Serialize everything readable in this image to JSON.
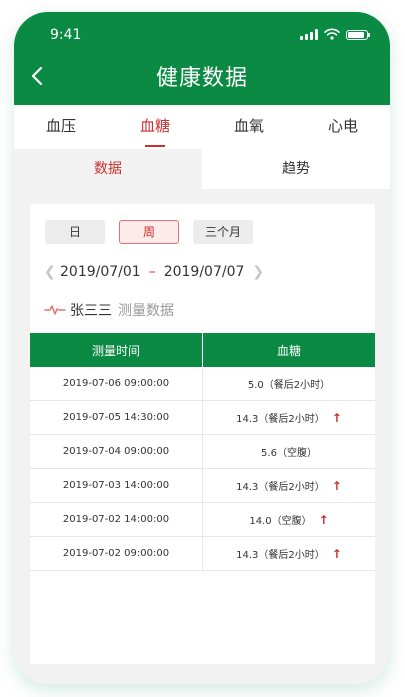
{
  "status_bar": {
    "time": "9:41"
  },
  "header": {
    "title": "健康数据"
  },
  "tabs": [
    {
      "label": "血压"
    },
    {
      "label": "血糖"
    },
    {
      "label": "血氧"
    },
    {
      "label": "心电"
    }
  ],
  "subtabs": [
    {
      "label": "数据"
    },
    {
      "label": "趋势"
    }
  ],
  "periods": [
    {
      "label": "日"
    },
    {
      "label": "周"
    },
    {
      "label": "三个月"
    }
  ],
  "date_range": {
    "start": "2019/07/01",
    "separator": "–",
    "end": "2019/07/07"
  },
  "person": {
    "name": "张三三",
    "label": "测量数据"
  },
  "table": {
    "headers": [
      "测量时间",
      "血糖"
    ],
    "rows": [
      {
        "time": "2019-07-06 09:00:00",
        "value": "5.0（餐后2小时）",
        "high": false
      },
      {
        "time": "2019-07-05 14:30:00",
        "value": "14.3（餐后2小时）",
        "high": true
      },
      {
        "time": "2019-07-04 09:00:00",
        "value": "5.6（空腹）",
        "high": false
      },
      {
        "time": "2019-07-03 14:00:00",
        "value": "14.3（餐后2小时）",
        "high": true
      },
      {
        "time": "2019-07-02 14:00:00",
        "value": "14.0（空腹）",
        "high": true
      },
      {
        "time": "2019-07-02 09:00:00",
        "value": "14.3（餐后2小时）",
        "high": true
      }
    ],
    "high_indicator": "↑"
  },
  "colors": {
    "brand": "#0b8a44",
    "accent": "#c9302c"
  }
}
